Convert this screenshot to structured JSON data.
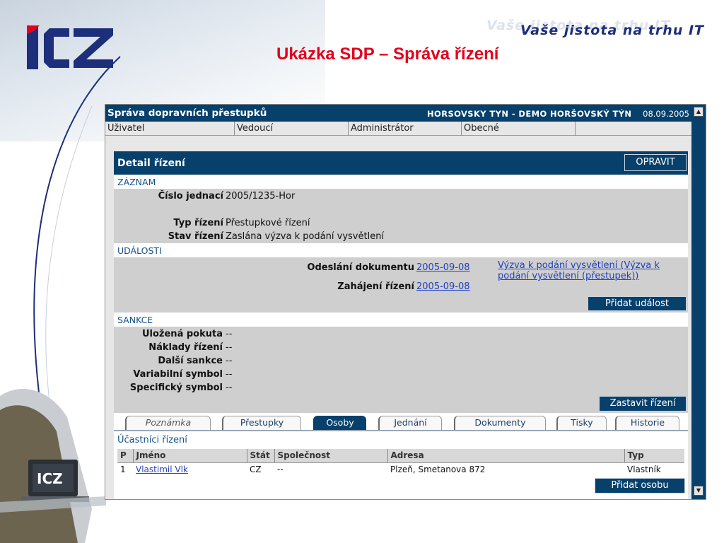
{
  "slide": {
    "slogan": "Vaše jistota na trhu IT",
    "title": "Ukázka SDP – Správa řízení",
    "logo_text": "ICZ",
    "brand_colors": {
      "logo_blue": "#1d2f7a",
      "logo_red": "#e3001b",
      "app_navy": "#06406b"
    }
  },
  "app": {
    "title": "Správa dopravních přestupků",
    "organization": "HORSOVSKY TYN - DEMO HORŠOVSKÝ TÝN",
    "date": "08.09.2005",
    "menu": [
      "Uživatel",
      "Vedoucí",
      "Administrátor",
      "Obecné"
    ]
  },
  "detail": {
    "title": "Detail řízení",
    "edit_button": "OPRAVIT",
    "record": {
      "section": "ZÁZNAM",
      "number_label": "Číslo jednací",
      "number_value": "2005/1235-Hor",
      "type_label": "Typ řízení",
      "type_value": "Přestupkové řízení",
      "status_label": "Stav řízení",
      "status_value": "Zaslána výzva k podání vysvětlení"
    },
    "events": {
      "section": "UDÁLOSTI",
      "items": [
        {
          "label": "Odeslání dokumentu",
          "date": "2005-09-08",
          "doc_line1": "Výzva k podání vysvětlení (Výzva k",
          "doc_line2": "podání vysvětlení (přestupek))"
        },
        {
          "label": "Zahájení řízení",
          "date": "2005-09-08"
        }
      ],
      "add_button": "Přidat událost"
    },
    "sanctions": {
      "section": "SANKCE",
      "items": [
        {
          "label": "Uložená pokuta",
          "value": "--"
        },
        {
          "label": "Náklady řízení",
          "value": "--"
        },
        {
          "label": "Další sankce",
          "value": "--"
        },
        {
          "label": "Variabilní symbol",
          "value": "--"
        },
        {
          "label": "Specifický symbol",
          "value": "--"
        }
      ],
      "stop_button": "Zastavit řízení"
    },
    "tabs": [
      "Poznámka",
      "Přestupky",
      "Osoby",
      "Jednání",
      "Dokumenty",
      "Tisky",
      "Historie"
    ],
    "active_tab": "Osoby",
    "participants": {
      "title": "Účastníci řízení",
      "columns": [
        "P",
        "Jméno",
        "Stát",
        "Společnost",
        "Adresa",
        "Typ"
      ],
      "rows": [
        {
          "p": "1",
          "name": "Vlastimil Vlk",
          "country": "CZ",
          "company": "--",
          "address": "Plzeň, Smetanova 872",
          "type": "Vlastník"
        }
      ],
      "add_button": "Přidat osobu"
    }
  }
}
